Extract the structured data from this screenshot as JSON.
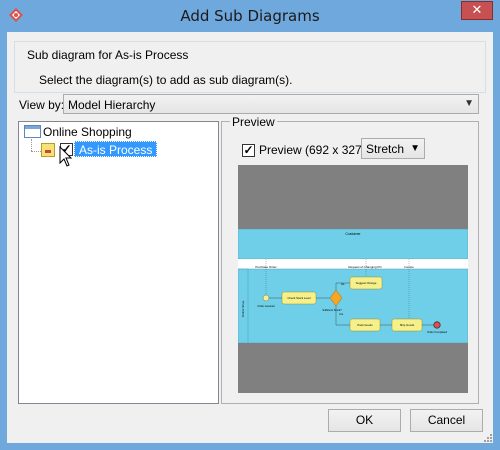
{
  "window": {
    "title": "Add Sub Diagrams",
    "close_label": "✕"
  },
  "group": {
    "legend": "Sub diagram for As-is Process",
    "instruction": "Select the diagram(s) to add as sub diagram(s)."
  },
  "view_by": {
    "label": "View by:",
    "selected": "Model Hierarchy"
  },
  "tree": {
    "root_label": "Online Shopping",
    "child_label": "As-is Process",
    "child_checked": true
  },
  "preview": {
    "legend": "Preview",
    "checkbox_label": "Preview  (692 x 327)",
    "checked": true,
    "mode_selected": "Stretch"
  },
  "diagram_text": {
    "lane_title": "Customer",
    "purchase_order": "Purchase Order",
    "request_change": "Request of Changing PO",
    "invoice": "Invoice",
    "no": "No",
    "yes": "Yes",
    "order_received": "Order received",
    "check_stock": "Check Stock Level",
    "sufficient_stock": "Sufficient Stock?",
    "suggest_change": "Suggest Change",
    "pack_goods": "Pack Goods",
    "ship_goods": "Ship Goods",
    "order_completed": "Order Completed",
    "pool_label": "Online Shop"
  },
  "buttons": {
    "ok": "OK",
    "cancel": "Cancel"
  },
  "colors": {
    "titlebar": "#6fa8dc",
    "selection": "#3399ff",
    "lane": "#6fcfe8",
    "task": "#f6f08a",
    "gateway": "#f5a623",
    "end_event": "#e84b4b"
  }
}
